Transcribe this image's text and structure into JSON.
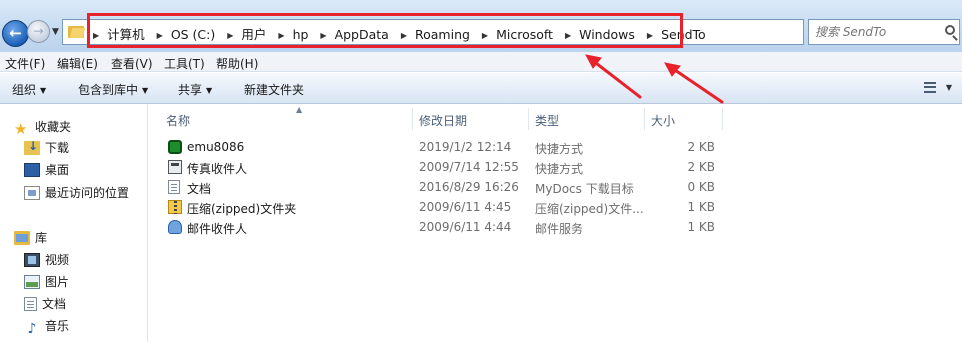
{
  "address_bar": {
    "crumbs": [
      "计算机",
      "OS (C:)",
      "用户",
      "hp",
      "AppData",
      "Roaming",
      "Microsoft",
      "Windows",
      "SendTo"
    ],
    "highlight_color": "#e8212b"
  },
  "search": {
    "placeholder": "搜索 SendTo"
  },
  "menu": [
    "文件(F)",
    "编辑(E)",
    "查看(V)",
    "工具(T)",
    "帮助(H)"
  ],
  "commands": {
    "organize": "组织",
    "include_in_library": "包含到库中",
    "share": "共享",
    "new_folder": "新建文件夹"
  },
  "sidebar": {
    "favorites": {
      "label": "收藏夹",
      "items": [
        "下载",
        "桌面",
        "最近访问的位置"
      ]
    },
    "libraries": {
      "label": "库",
      "items": [
        "视频",
        "图片",
        "文档",
        "音乐"
      ]
    }
  },
  "columns": {
    "name": "名称",
    "date": "修改日期",
    "type": "类型",
    "size": "大小"
  },
  "files": [
    {
      "icon": "emu8086-icon",
      "name": "emu8086",
      "date": "2019/1/2 12:14",
      "type": "快捷方式",
      "size": "2 KB"
    },
    {
      "icon": "fax-icon",
      "name": "传真收件人",
      "date": "2009/7/14 12:55",
      "type": "快捷方式",
      "size": "2 KB"
    },
    {
      "icon": "document-icon",
      "name": "文档",
      "date": "2016/8/29 16:26",
      "type": "MyDocs 下载目标",
      "size": "0 KB"
    },
    {
      "icon": "zip-folder-icon",
      "name": "压缩(zipped)文件夹",
      "date": "2009/6/11 4:45",
      "type": "压缩(zipped)文件...",
      "size": "1 KB"
    },
    {
      "icon": "mail-icon",
      "name": "邮件收件人",
      "date": "2009/6/11 4:44",
      "type": "邮件服务",
      "size": "1 KB"
    }
  ]
}
